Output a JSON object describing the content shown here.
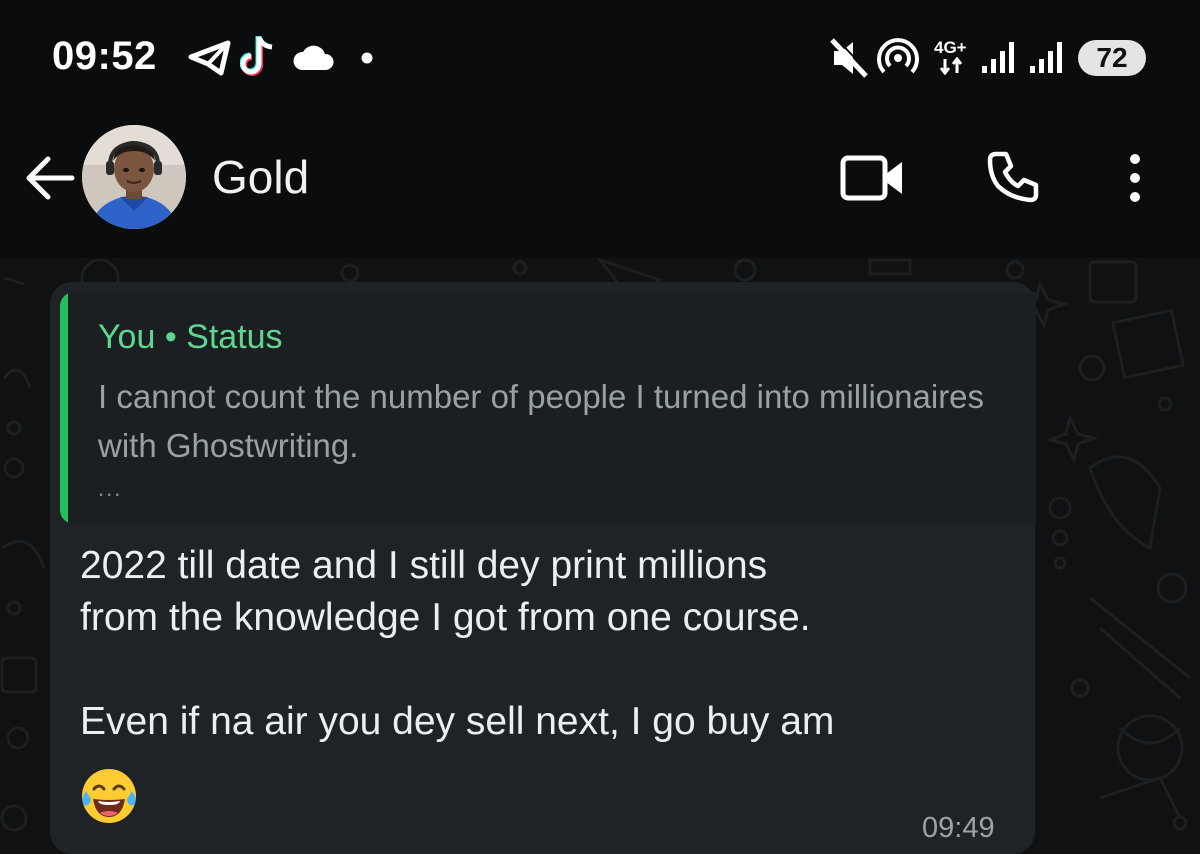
{
  "status_bar": {
    "time": "09:52",
    "battery": "72",
    "network": "4G+",
    "icons": [
      "telegram-icon",
      "tiktok-icon",
      "cloud-icon",
      "dot-icon",
      "mute-icon",
      "hotspot-icon",
      "network-4g-icon",
      "signal-icon",
      "signal-icon",
      "battery-icon"
    ]
  },
  "header": {
    "contact_name": "Gold",
    "icons": [
      "back-arrow-icon",
      "video-call-icon",
      "voice-call-icon",
      "more-options-icon"
    ]
  },
  "message": {
    "quote_author": "You • Status",
    "quote_text": "I cannot count the number of people I turned into millionaires with Ghostwriting.",
    "quote_more": "...",
    "body": "2022 till date and I still dey print millions\nfrom the knowledge I got from one course.\n\nEven if na air you dey sell next, I go buy am",
    "emoji": "tears-of-joy-emoji",
    "time": "09:49"
  },
  "colors": {
    "background": "#0b0c0d",
    "bubble": "#1f2326",
    "quote_accent": "#21c063",
    "quote_author": "#5fd690"
  }
}
